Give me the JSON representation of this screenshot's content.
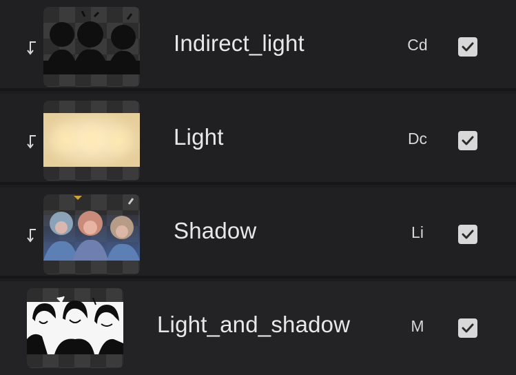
{
  "layers_panel": {
    "layers": [
      {
        "name": "Indirect_light",
        "blend_mode": "Cd",
        "visible": true,
        "clipped": true,
        "thumbnail": "dark-silhouettes"
      },
      {
        "name": "Light",
        "blend_mode": "Dc",
        "visible": true,
        "clipped": true,
        "thumbnail": "warm-glow"
      },
      {
        "name": "Shadow",
        "blend_mode": "Li",
        "visible": true,
        "clipped": true,
        "thumbnail": "blue-shadow-figures"
      },
      {
        "name": "Light_and_shadow",
        "blend_mode": "M",
        "visible": true,
        "clipped": false,
        "thumbnail": "black-white-lineart"
      }
    ]
  },
  "icons": {
    "clip": "clipping-mask-arrow-icon",
    "visibility": "checkmark-icon"
  },
  "colors": {
    "panel_bg": "#1c1c1e",
    "row_bg": "#202022",
    "text": "#e8e8e8",
    "checkbox": "#d8d8d8"
  }
}
